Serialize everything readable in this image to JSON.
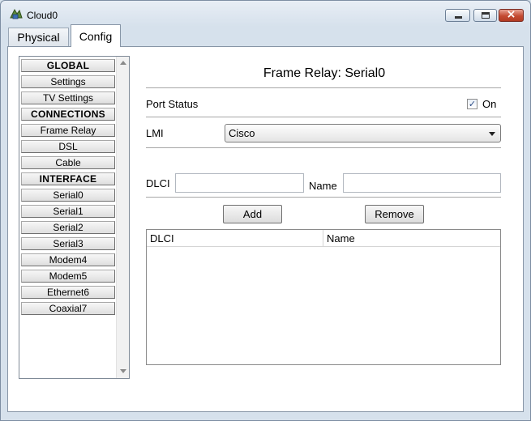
{
  "window": {
    "title": "Cloud0"
  },
  "tabs": [
    {
      "label": "Physical"
    },
    {
      "label": "Config"
    }
  ],
  "nav": {
    "items": [
      {
        "label": "GLOBAL",
        "header": true
      },
      {
        "label": "Settings"
      },
      {
        "label": "TV Settings"
      },
      {
        "label": "CONNECTIONS",
        "header": true
      },
      {
        "label": "Frame Relay"
      },
      {
        "label": "DSL"
      },
      {
        "label": "Cable"
      },
      {
        "label": "INTERFACE",
        "header": true
      },
      {
        "label": "Serial0"
      },
      {
        "label": "Serial1"
      },
      {
        "label": "Serial2"
      },
      {
        "label": "Serial3"
      },
      {
        "label": "Modem4"
      },
      {
        "label": "Modem5"
      },
      {
        "label": "Ethernet6"
      },
      {
        "label": "Coaxial7"
      }
    ]
  },
  "panel": {
    "title": "Frame Relay: Serial0",
    "port_status_label": "Port Status",
    "port_status_on_label": "On",
    "port_status_checked": true,
    "lmi_label": "LMI",
    "lmi_value": "Cisco",
    "dlci_label": "DLCI",
    "dlci_value": "",
    "name_label": "Name",
    "name_value": "",
    "add_label": "Add",
    "remove_label": "Remove",
    "table_headers": [
      "DLCI",
      "Name"
    ],
    "table_rows": []
  },
  "icons": {
    "app": "cloud-icon",
    "checkmark": "✓"
  },
  "colors": {
    "window_frame": "#d6e1ec",
    "close_button": "#c44b32",
    "check": "#2a4b86"
  }
}
